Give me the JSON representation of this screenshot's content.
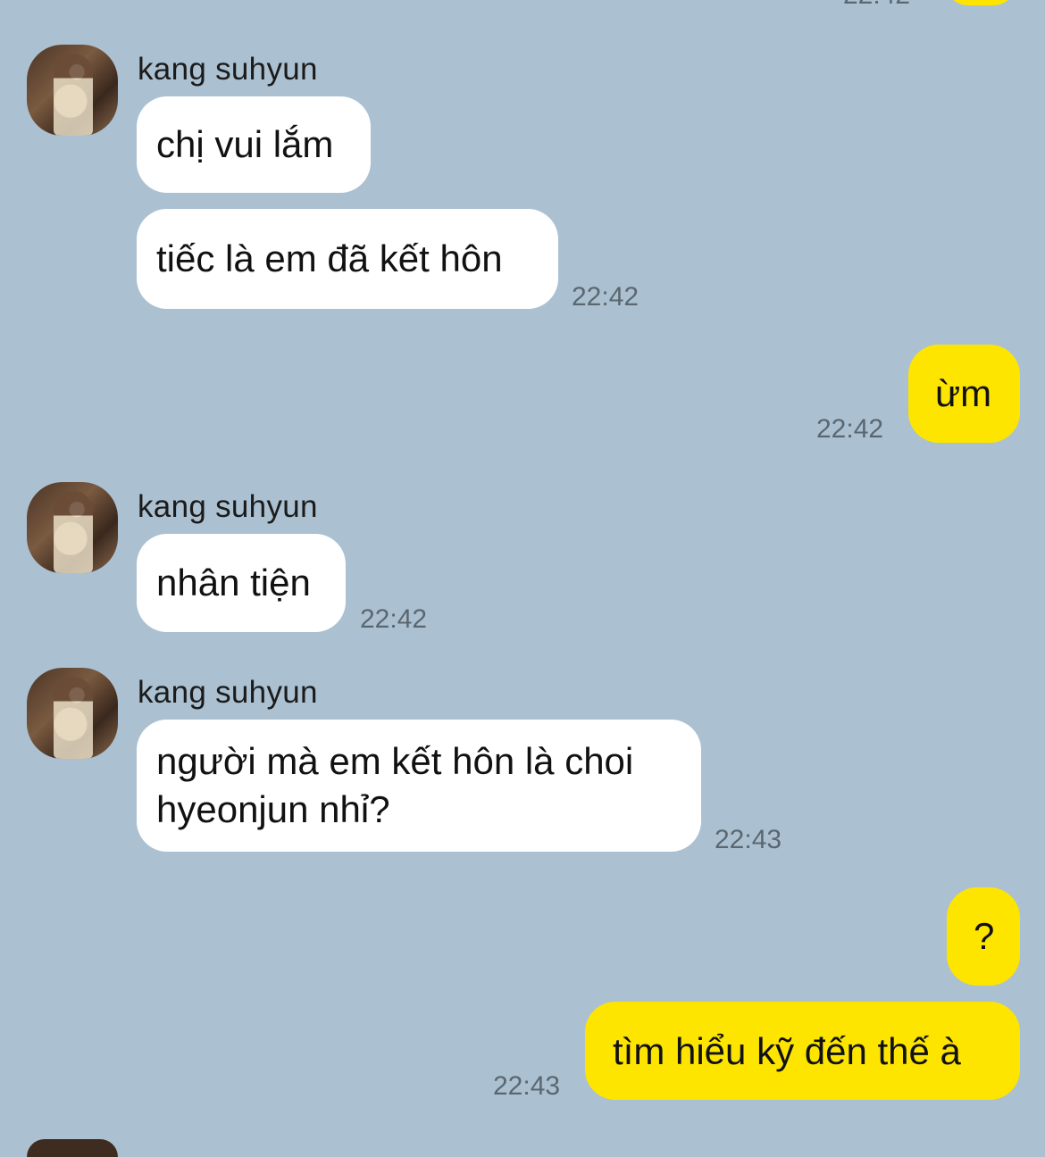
{
  "header_partial": {
    "time": "22:42"
  },
  "messages": [
    {
      "from": "kang suhyun",
      "name": "kang suhyun",
      "text": "chị vui lắm"
    },
    {
      "from": "kang suhyun",
      "text": "tiếc là em đã kết hôn",
      "time": "22:42"
    },
    {
      "from": "me",
      "text": "ừm",
      "time": "22:42"
    },
    {
      "from": "kang suhyun",
      "name": "kang suhyun",
      "text": "nhân tiện",
      "time": "22:42"
    },
    {
      "from": "kang suhyun",
      "name": "kang suhyun",
      "text_line1": "người mà em kết hôn là choi",
      "text_line2": "hyeonjun nhỉ?",
      "time": "22:43"
    },
    {
      "from": "me",
      "text": "?"
    },
    {
      "from": "me",
      "text": "tìm hiểu kỹ đến thế à",
      "time": "22:43"
    }
  ],
  "colors": {
    "background": "#abc1d1",
    "incoming": "#ffffff",
    "outgoing": "#fee500"
  }
}
